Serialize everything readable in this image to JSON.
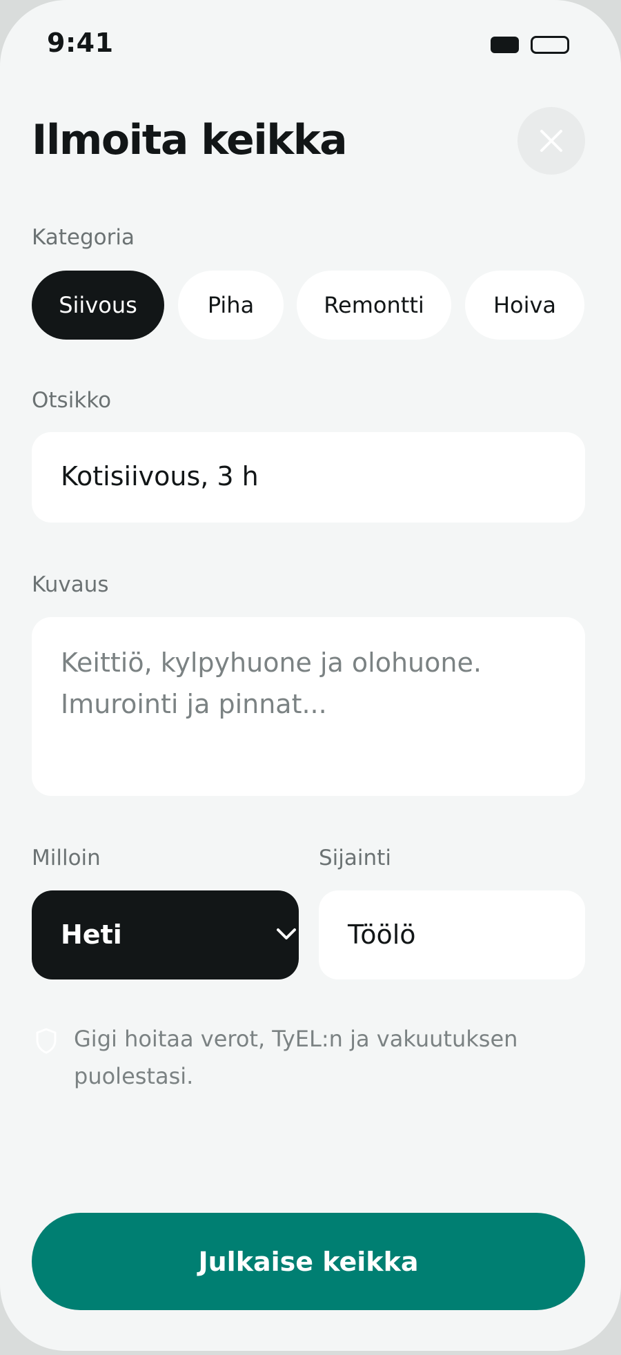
{
  "status_bar": {
    "time": "9:41"
  },
  "header": {
    "title": "Ilmoita keikka",
    "close_icon": "close-icon"
  },
  "category": {
    "label": "Kategoria",
    "chips": [
      "Siivous",
      "Piha",
      "Remontti",
      "Hoiva"
    ],
    "selected": "Siivous"
  },
  "title_field": {
    "label": "Otsikko",
    "value": "Kotisiivous, 3 h"
  },
  "description_field": {
    "label": "Kuvaus",
    "placeholder": "Keittiö, kylpyhuone ja olohuone.\nImurointi ja pinnat..."
  },
  "when_field": {
    "label": "Milloin",
    "value": "Heti",
    "icon": "chevron-down-icon"
  },
  "location_field": {
    "label": "Sijainti",
    "value": "Töölö"
  },
  "info": {
    "icon": "shield-icon",
    "text": "Gigi hoitaa verot, TyEL:n ja vakuutuksen puolestasi."
  },
  "publish_button": {
    "label": "Julkaise keikka"
  },
  "colors": {
    "accent": "#007f72",
    "dark": "#121617",
    "background": "#f4f6f6",
    "muted_text": "#6b7273"
  }
}
